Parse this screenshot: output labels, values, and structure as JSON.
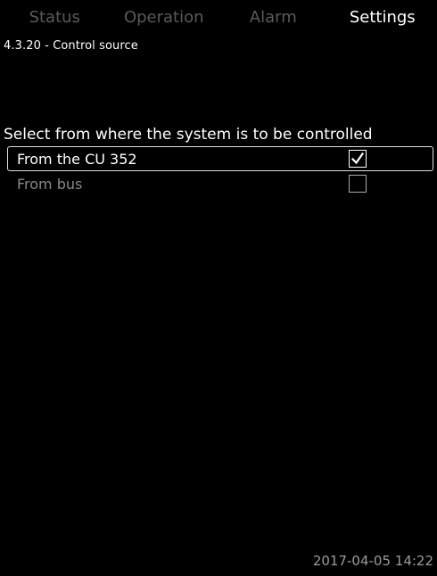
{
  "tabs": [
    {
      "label": "Status",
      "active": false
    },
    {
      "label": "Operation",
      "active": false
    },
    {
      "label": "Alarm",
      "active": false
    },
    {
      "label": "Settings",
      "active": true
    }
  ],
  "breadcrumb": "4.3.20 - Control source",
  "instruction": "Select from where the system is to be controlled",
  "options": [
    {
      "label": "From the CU 352",
      "checked": true,
      "selected": true
    },
    {
      "label": "From bus",
      "checked": false,
      "selected": false
    }
  ],
  "footer": {
    "datetime": "2017-04-05 14:22"
  },
  "colors": {
    "background": "#000000",
    "text": "#ffffff",
    "inactive_tab": "#5a5a5a",
    "inactive_option": "#888888"
  }
}
